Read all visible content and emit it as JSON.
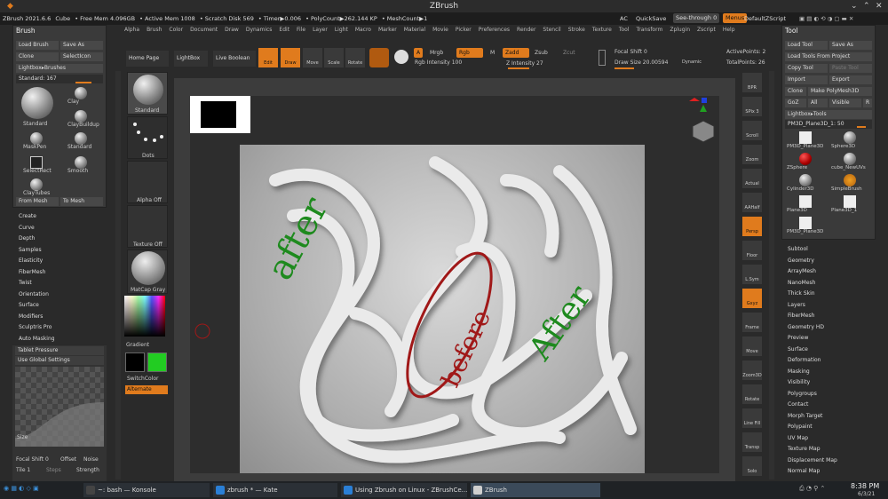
{
  "window": {
    "title": "ZBrush"
  },
  "info": {
    "version": "ZBrush 2021.6.6",
    "object": "Cube",
    "free_mem": "• Free Mem 4.096GB",
    "active_mem": "• Active Mem 1008",
    "scratch": "• Scratch Disk 569",
    "timer": "• Timer▶0.006",
    "polycount": "• PolyCount▶262.144 KP",
    "meshcount": "• MeshCount▶1",
    "ac": "AC",
    "quicksave": "QuickSave",
    "seethrough": "See-through  0",
    "menus": "Menus",
    "defaultzscript": "DefaultZScript"
  },
  "menu": [
    "Alpha",
    "Brush",
    "Color",
    "Document",
    "Draw",
    "Dynamics",
    "Edit",
    "File",
    "Layer",
    "Light",
    "Macro",
    "Marker",
    "Material",
    "Movie",
    "Picker",
    "Preferences",
    "Render",
    "Stencil",
    "Stroke",
    "Texture",
    "Tool",
    "Transform",
    "Zplugin",
    "Zscript",
    "Help"
  ],
  "brush_palette": {
    "title": "Brush",
    "load": "Load Brush",
    "save": "Save As",
    "clone": "Clone",
    "selecticon": "SelectIcon",
    "lightbox": "Lightbox▸Brushes",
    "standard_label": "Standard: 167",
    "r": "R",
    "items": [
      "Standard",
      "Clay",
      "ClayBuildup",
      "MaskPen",
      "Standard",
      "SelectRect",
      "Smooth",
      "ClayTubes"
    ],
    "frommesh": "From Mesh",
    "tomesh": "To Mesh",
    "list": [
      "Create",
      "Curve",
      "Depth",
      "Samples",
      "Elasticity",
      "FiberMesh",
      "Twist",
      "Orientation",
      "Surface",
      "Modifiers",
      "Sculptris Pro",
      "Auto Masking"
    ],
    "tablet": "Tablet Pressure",
    "global": "Use Global Settings",
    "size": "Size",
    "focal": "Focal Shift 0",
    "offset": "Offset",
    "noise": "Noise",
    "tile": "Tile 1",
    "steps": "Steps",
    "strength": "Strength"
  },
  "shelf": {
    "standard": "Standard",
    "dots": "Dots",
    "alpha": "Alpha Off",
    "texture": "Texture Off",
    "matcap": "MatCap Gray",
    "gradient": "Gradient",
    "switchcolor": "SwitchColor",
    "alternate": "Alternate",
    "primary_color": "#000000",
    "secondary_color": "#22cc22"
  },
  "toolbar": {
    "homepage": "Home Page",
    "lightbox": "LightBox",
    "liveboolean": "Live Boolean",
    "edit": "Edit",
    "draw": "Draw",
    "move": "Move",
    "scale": "Scale",
    "rotate": "Rotate",
    "a": "A",
    "mrgb": "Mrgb",
    "rgb": "Rgb",
    "m": "M",
    "rgb_intensity": "Rgb Intensity 100",
    "zadd": "Zadd",
    "zsub": "Zsub",
    "zcut": "Zcut",
    "z_intensity": "Z Intensity 27",
    "focal": "Focal Shift 0",
    "drawsize": "Draw Size 20.00594",
    "dynamic": "Dynamic",
    "active_points": "ActivePoints: 2",
    "total_points": "TotalPoints: 26"
  },
  "canvas": {
    "annot_after1": "after",
    "annot_before": "before",
    "annot_after2": "After"
  },
  "rightshelf": [
    "BPR",
    "SPix 3",
    "Scroll",
    "Zoom",
    "Actual",
    "AAHalf",
    "Persp",
    "Floor",
    "L.Sym",
    "Gxyz",
    "Frame",
    "Move",
    "Zoom3D",
    "Rotate",
    "Line Fill",
    "Transp",
    "Solo"
  ],
  "tool_palette": {
    "title": "Tool",
    "load": "Load Tool",
    "saveas": "Save As",
    "loadproject": "Load Tools From Project",
    "copy": "Copy Tool",
    "paste": "Paste Tool",
    "import": "Import",
    "export": "Export",
    "clone": "Clone",
    "makepoly": "Make PolyMesh3D",
    "goz": "GoZ",
    "all": "All",
    "visible": "Visible",
    "r": "R",
    "lightbox": "Lightbox▸Tools",
    "current": "PM3D_Plane3D_1: 50",
    "items": [
      "PM3D_Plane3D",
      "Sphere3D",
      "ZSphere",
      "cube_NewUVs",
      "Cylinder3D",
      "SimpleBrush",
      "Plane3D",
      "Plane3D_1",
      "PM3D_Plane3D"
    ],
    "list": [
      "Subtool",
      "Geometry",
      "ArrayMesh",
      "NanoMesh",
      "Thick Skin",
      "Layers",
      "FiberMesh",
      "Geometry HD",
      "Preview",
      "Surface",
      "Deformation",
      "Masking",
      "Visibility",
      "Polygroups",
      "Contact",
      "Morph Target",
      "Polypaint",
      "UV Map",
      "Texture Map",
      "Displacement Map",
      "Normal Map"
    ]
  },
  "taskbar": {
    "tasks": [
      "~: bash — Konsole",
      "zbrush * — Kate",
      "Using Zbrush on Linux - ZBrushCe...",
      "ZBrush"
    ],
    "time": "8:38 PM",
    "date": "6/3/21"
  }
}
